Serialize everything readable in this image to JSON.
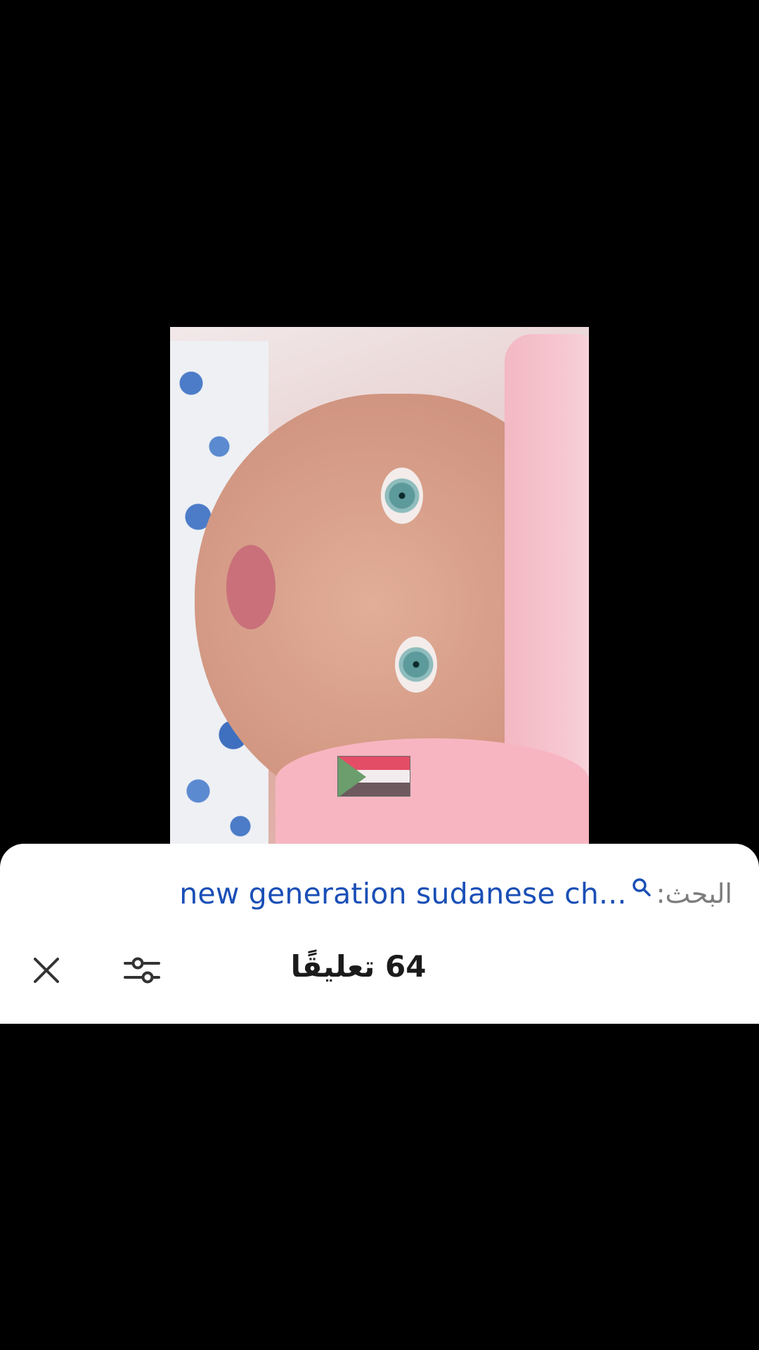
{
  "search": {
    "prefix_label": "البحث:",
    "query_text": "new generation sudanese ch..."
  },
  "comments": {
    "title": "64 تعليقًا"
  },
  "icons": {
    "search": "search-icon",
    "close": "close-icon",
    "filter": "sliders-icon",
    "flag": "sudan-flag-icon"
  },
  "colors": {
    "sheet_background": "#ffffff",
    "search_query": "#1a4fb6",
    "search_prefix": "#7c7c7c",
    "title_text": "#1b1b1b",
    "video_letterbox": "#000000"
  }
}
